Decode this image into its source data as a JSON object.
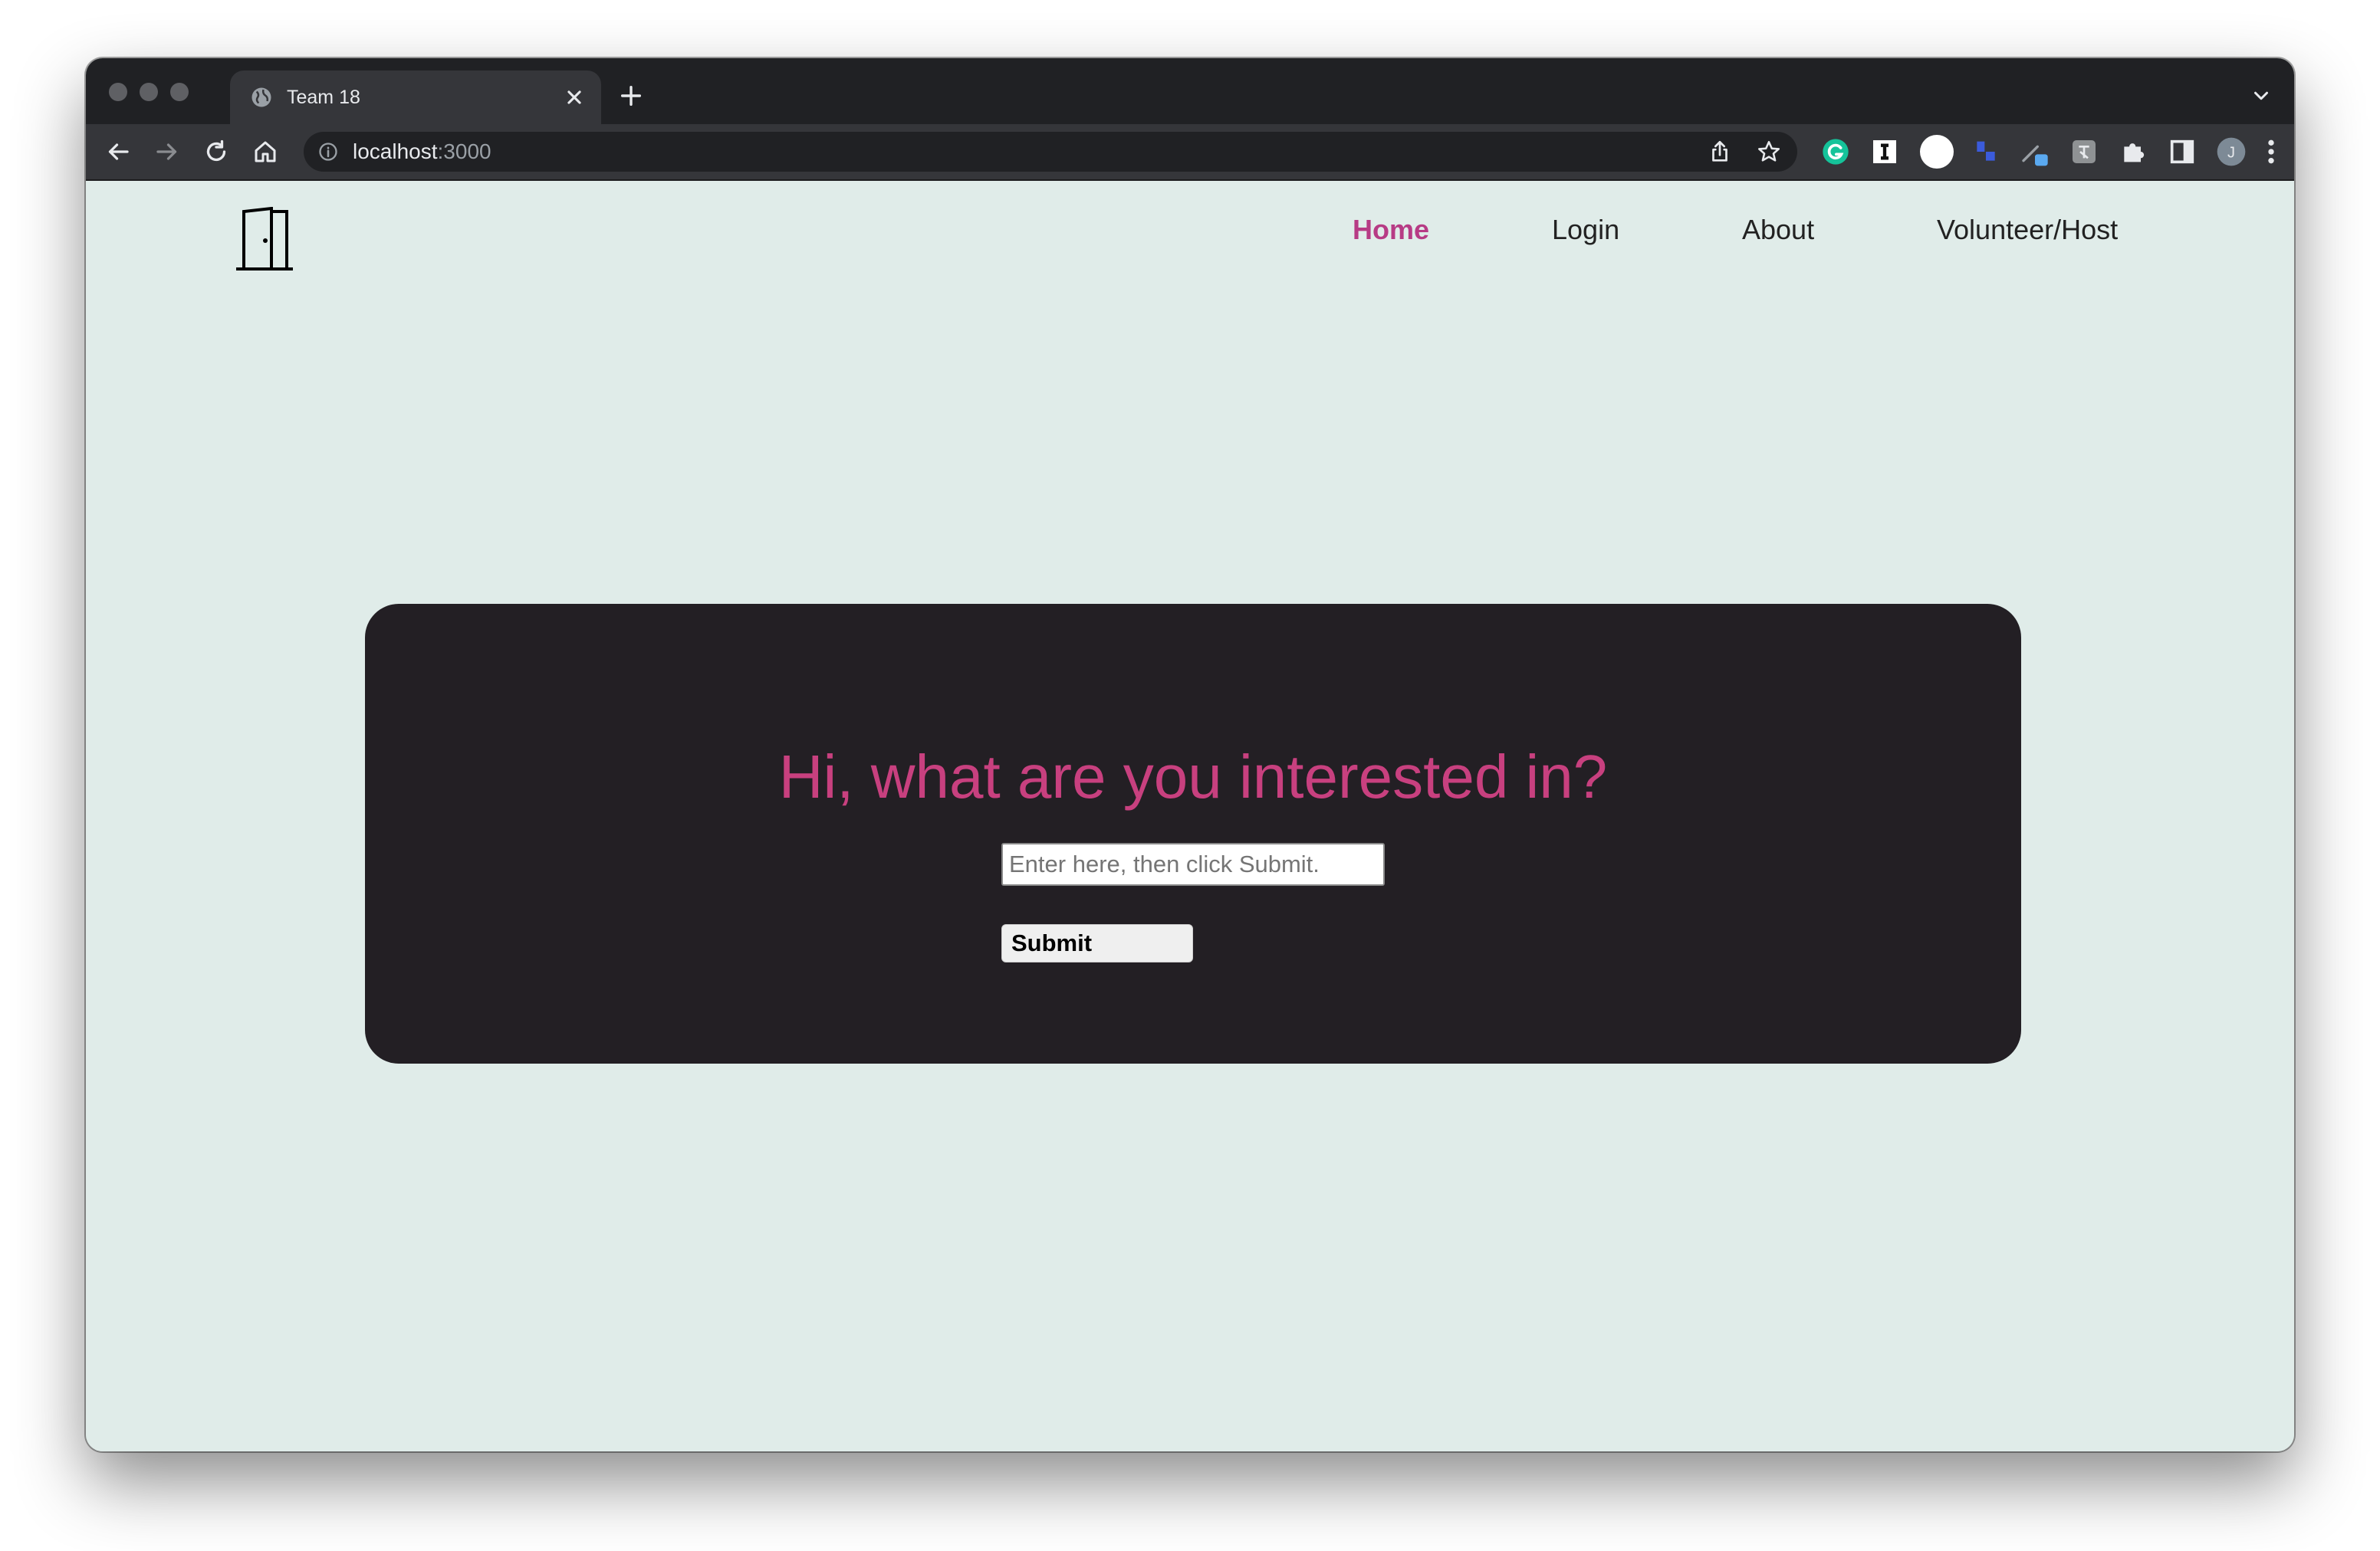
{
  "browser": {
    "tab_title": "Team 18",
    "url_host": "localhost",
    "url_port": ":3000",
    "extension_icons": [
      "grammarly-icon",
      "instapaper-icon",
      "circle-extension-icon",
      "blue-extension-icon",
      "pen-extension-icon",
      "translate-extension-icon",
      "puzzle-icon",
      "sidepanel-icon"
    ],
    "profile_initial": "J"
  },
  "nav": {
    "items": [
      {
        "label": "Home",
        "active": true
      },
      {
        "label": "Login",
        "active": false
      },
      {
        "label": "About",
        "active": false
      },
      {
        "label": "Volunteer/Host",
        "active": false
      }
    ]
  },
  "main": {
    "heading": "Hi, what are you interested in?",
    "input_placeholder": "Enter here, then click Submit.",
    "input_value": "",
    "submit_label": "Submit"
  },
  "colors": {
    "accent": "#c8407f",
    "page_bg": "#e0ece9",
    "card_bg": "#231f24"
  }
}
